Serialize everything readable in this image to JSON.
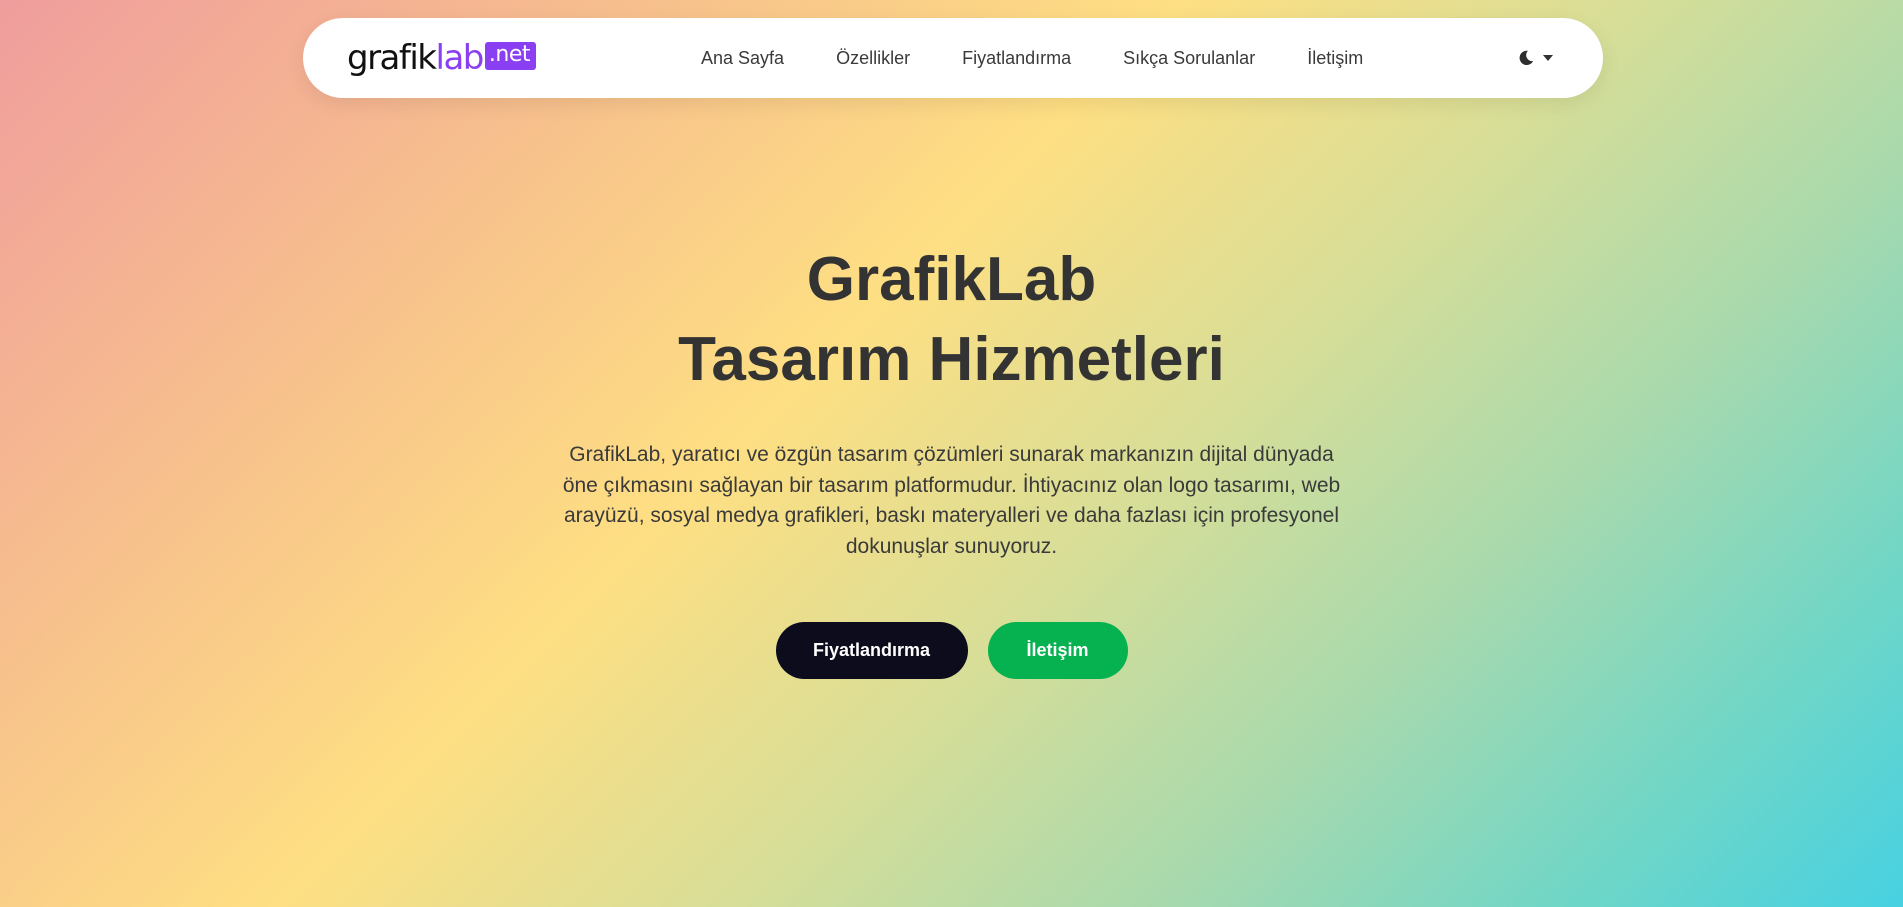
{
  "navbar": {
    "logo": {
      "text_main": "grafik",
      "text_accent": "lab",
      "badge": ".net"
    },
    "links": [
      {
        "label": "Ana Sayfa",
        "name": "nav-link-home"
      },
      {
        "label": "Özellikler",
        "name": "nav-link-features"
      },
      {
        "label": "Fiyatlandırma",
        "name": "nav-link-pricing"
      },
      {
        "label": "Sıkça Sorulanlar",
        "name": "nav-link-faq"
      },
      {
        "label": "İletişim",
        "name": "nav-link-contact"
      }
    ],
    "theme_toggle": {
      "icon": "moon-icon",
      "dropdown_icon": "caret-down-icon"
    }
  },
  "hero": {
    "title_line1": "GrafikLab",
    "title_line2": "Tasarım Hizmetleri",
    "description": "GrafikLab, yaratıcı ve özgün tasarım çözümleri sunarak markanızın dijital dünyada öne çıkmasını sağlayan bir tasarım platformudur. İhtiyacınız olan logo tasarımı, web arayüzü, sosyal medya grafikleri, baskı materyalleri ve daha fazlası için profesyonel dokunuşlar sunuyoruz.",
    "primary_button": "Fiyatlandırma",
    "secondary_button": "İletişim"
  },
  "colors": {
    "brand_purple": "#8b3ff2",
    "button_dark": "#0c0c1c",
    "button_green": "#06b150",
    "text_dark": "#333333"
  }
}
